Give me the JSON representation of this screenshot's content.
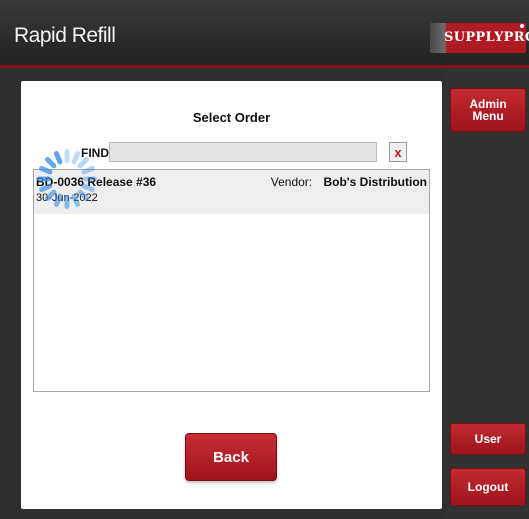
{
  "header": {
    "title": "Rapid Refill",
    "logo_text": "SUPPLYPRO"
  },
  "sidebar": {
    "admin_menu_label": "Admin Menu",
    "user_label": "User",
    "logout_label": "Logout"
  },
  "panel": {
    "title": "Select Order",
    "find_label": "FIND:",
    "find_value": "",
    "clear_label": "x",
    "back_label": "Back"
  },
  "orders": [
    {
      "order": "BD-0036 Release #36",
      "date": "30-Jun-2022",
      "vendor_label": "Vendor:",
      "vendor": "Bob's Distribution"
    }
  ],
  "colors": {
    "accent": "#b01a22",
    "header_bg": "#2a2a2a",
    "row_bg": "#eeeeee"
  },
  "icons": {
    "loading": "loading-spinner-icon",
    "clear": "close-icon"
  }
}
